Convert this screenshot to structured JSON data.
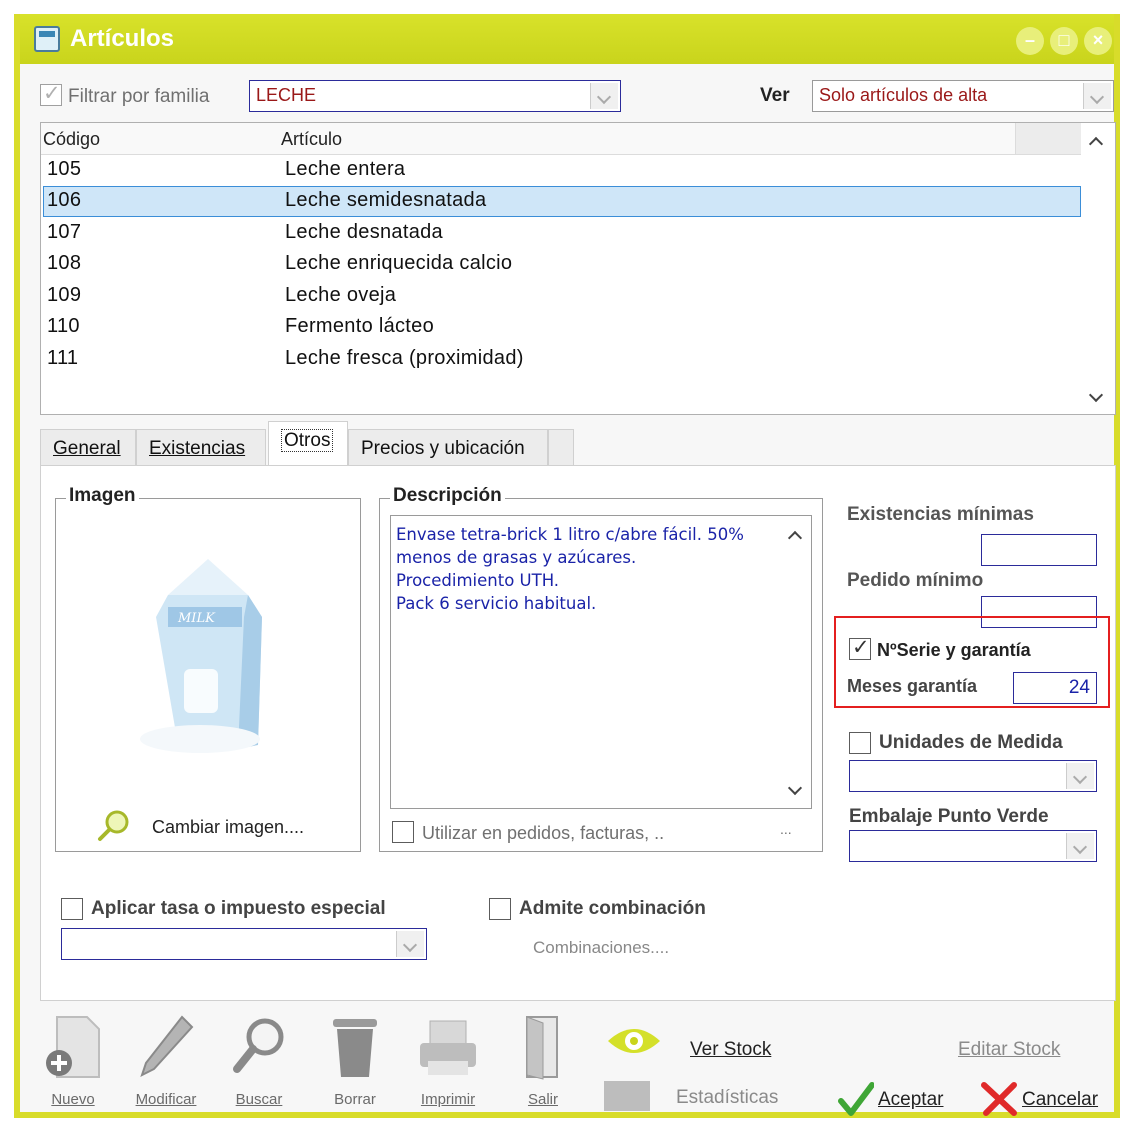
{
  "window": {
    "title": "Artículos",
    "controls": [
      "–",
      "□",
      "×"
    ]
  },
  "filter": {
    "checkbox_label": "Filtrar por familia",
    "family_value": "LECHE",
    "ver_label": "Ver",
    "ver_value": "Solo artículos de alta"
  },
  "grid": {
    "columns": [
      "Código",
      "Artículo"
    ],
    "rows": [
      {
        "code": "105",
        "name": "Leche entera"
      },
      {
        "code": "106",
        "name": "Leche semidesnatada"
      },
      {
        "code": "107",
        "name": "Leche desnatada"
      },
      {
        "code": "108",
        "name": "Leche enriquecida calcio"
      },
      {
        "code": "109",
        "name": "Leche oveja"
      },
      {
        "code": "110",
        "name": "Fermento lácteo"
      },
      {
        "code": "111",
        "name": "Leche fresca (proximidad)"
      }
    ],
    "selected_index": 1
  },
  "tabs": [
    "General",
    "Existencias",
    "Otros",
    "Precios y ubicación"
  ],
  "active_tab": "Otros",
  "imagen": {
    "title": "Imagen",
    "change_label": "Cambiar imagen....",
    "product_label": "MILK"
  },
  "descripcion": {
    "title": "Descripción",
    "text": "Envase tetra-brick 1 litro c/abre fácil. 50%\nmenos de grasas y azúcares.\nProcedimiento UTH.\nPack 6 servicio habitual.",
    "use_label": "Utilizar en pedidos, facturas, ..",
    "ellipsis": "..."
  },
  "right": {
    "existencias_label": "Existencias mínimas",
    "existencias_value": "",
    "pedido_label": "Pedido mínimo",
    "pedido_value": "",
    "serie_label": "NºSerie y garantía",
    "meses_label": "Meses garantía",
    "meses_value": "24",
    "unidades_label": "Unidades de Medida",
    "embalaje_label": "Embalaje Punto Verde"
  },
  "bottom": {
    "tasa_label": "Aplicar tasa o impuesto especial",
    "combinacion_label": "Admite combinación",
    "combinaciones_label": "Combinaciones...."
  },
  "toolbar": {
    "nuevo": "Nuevo",
    "modificar": "Modificar",
    "buscar": "Buscar",
    "borrar": "Borrar",
    "imprimir": "Imprimir",
    "salir": "Salir",
    "ver_stock": "Ver Stock",
    "estadisticas": "Estadísticas",
    "editar_stock": "Editar Stock",
    "aceptar": "Aceptar",
    "cancelar": "Cancelar"
  },
  "colors": {
    "titlebar": "#d0db22",
    "selected_row": "#cfe6f8",
    "highlight_box": "#e41f1f",
    "description_text": "#1a23a8"
  }
}
